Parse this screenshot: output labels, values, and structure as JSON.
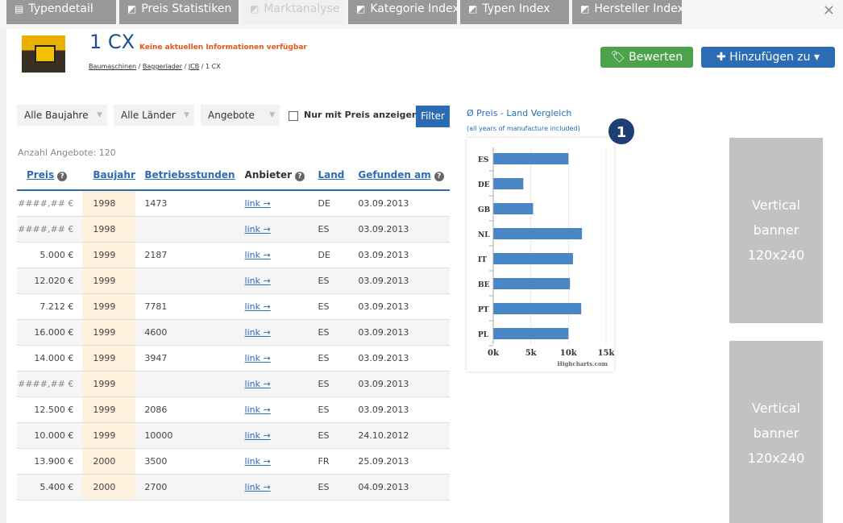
{
  "tabs": [
    {
      "label": "Typendetail"
    },
    {
      "label": "Preis Statistiken"
    },
    {
      "label": "Marktanalyse"
    },
    {
      "label": "Kategorie Index"
    },
    {
      "label": "Typen Index"
    },
    {
      "label": "Hersteller Index"
    }
  ],
  "close_label": "×",
  "header": {
    "title": "1 CX",
    "warning": "Keine aktuellen Informationen verfügbar",
    "breadcrumb": [
      "Baumaschinen",
      "Baggerlader",
      "JCB",
      "1 CX"
    ],
    "rate_button": "Bewerten",
    "add_button": "Hinzufügen zu ▾"
  },
  "filters": {
    "year": "Alle Baujahre",
    "country": "Alle Länder",
    "offers": "Angebote",
    "price_only": "Nur mit Preis anzeigen",
    "filter_button": "Filter"
  },
  "count_label": "Anzahl Angebote: 120",
  "table": {
    "headers": [
      "Preis",
      "Baujahr",
      "Betriebsstunden",
      "Anbieter",
      "Land",
      "Gefunden am"
    ],
    "rows": [
      [
        "####,## €",
        "1998",
        "1473",
        "link →",
        "DE",
        "03.09.2013"
      ],
      [
        "####,## €",
        "1998",
        "",
        "link →",
        "ES",
        "03.09.2013"
      ],
      [
        "5.000 €",
        "1999",
        "2187",
        "link →",
        "DE",
        "03.09.2013"
      ],
      [
        "12.020 €",
        "1999",
        "",
        "link →",
        "ES",
        "03.09.2013"
      ],
      [
        "7.212 €",
        "1999",
        "7781",
        "link →",
        "ES",
        "03.09.2013"
      ],
      [
        "16.000 €",
        "1999",
        "4600",
        "link →",
        "ES",
        "03.09.2013"
      ],
      [
        "14.000 €",
        "1999",
        "3947",
        "link →",
        "ES",
        "03.09.2013"
      ],
      [
        "####,## €",
        "1999",
        "",
        "link →",
        "ES",
        "03.09.2013"
      ],
      [
        "12.500 €",
        "1999",
        "2086",
        "link →",
        "ES",
        "03.09.2013"
      ],
      [
        "10.000 €",
        "1999",
        "10000",
        "link →",
        "ES",
        "24.10.2012"
      ],
      [
        "13.900 €",
        "2000",
        "3500",
        "link →",
        "FR",
        "25.09.2013"
      ],
      [
        "5.400 €",
        "2000",
        "2700",
        "link →",
        "ES",
        "04.09.2013"
      ]
    ]
  },
  "chart_title": "Ø Preis - Land Vergleich",
  "chart_subtitle": "(all years of manufacture included)",
  "chart_data": {
    "type": "bar",
    "orientation": "horizontal",
    "categories": [
      "ES",
      "DE",
      "GB",
      "NL",
      "IT",
      "BE",
      "PT",
      "PL"
    ],
    "values": [
      10000,
      4000,
      5300,
      11800,
      10600,
      10200,
      11700,
      10000
    ],
    "xlim": [
      0,
      15000
    ],
    "xticks": [
      "0k",
      "5k",
      "10k",
      "15k"
    ],
    "credit": "Highcharts.com",
    "bar_color": "#4a85c6",
    "grid": true
  },
  "badge": "1",
  "banners": [
    {
      "lines": [
        "Vertical",
        "banner",
        "120x240"
      ]
    },
    {
      "lines": [
        "Vertical",
        "banner",
        "120x240"
      ]
    }
  ]
}
